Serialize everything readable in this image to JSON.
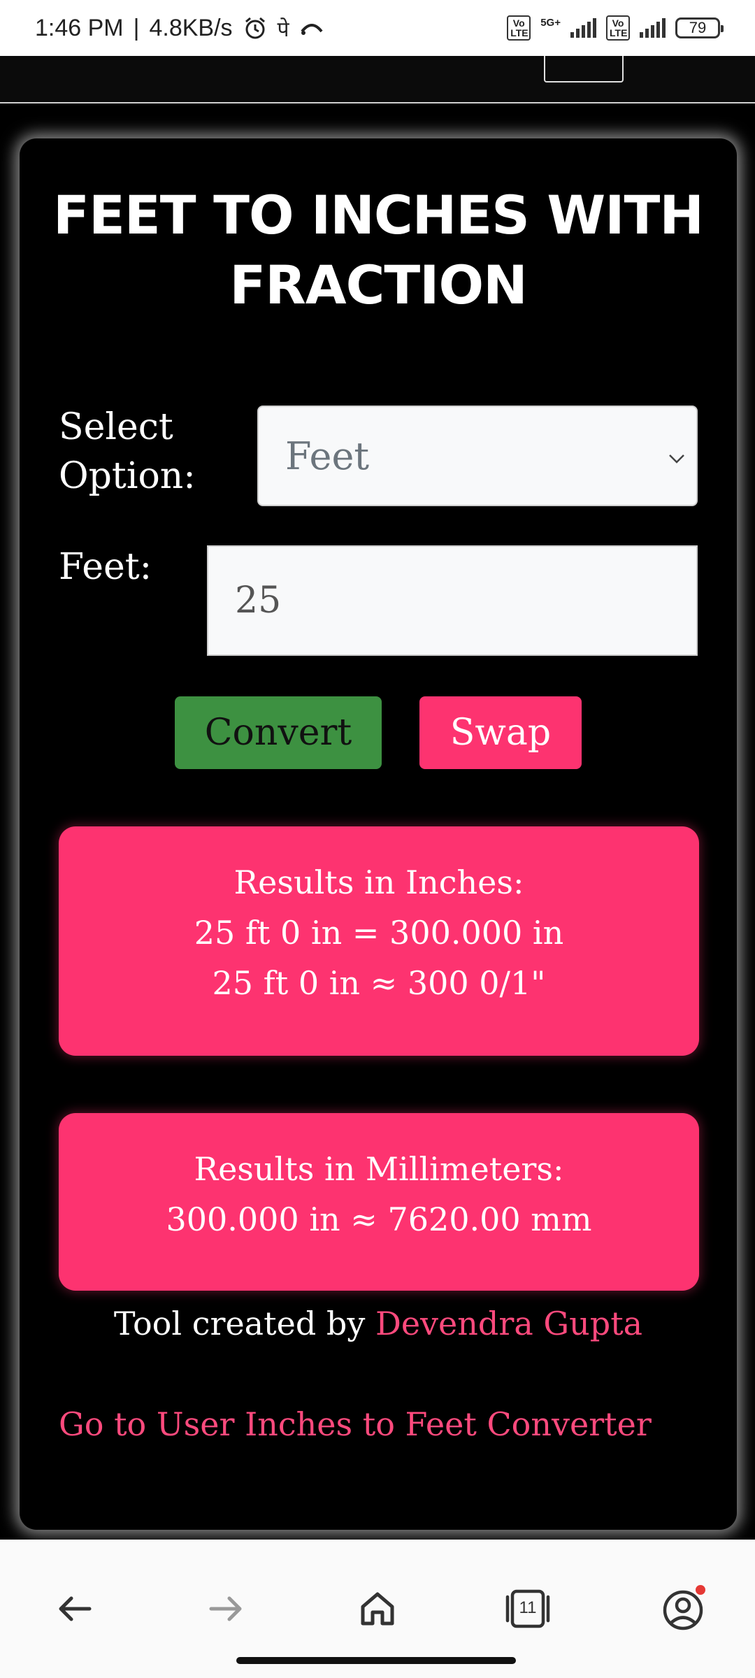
{
  "status_bar": {
    "time": "1:46 PM",
    "speed": "4.8KB/s",
    "network": "5G+",
    "volte_label": "Vo LTE",
    "battery": "79"
  },
  "converter": {
    "title": "FEET TO INCHES WITH FRACTION",
    "select_label": "Select Option:",
    "select_value": "Feet",
    "feet_label": "Feet:",
    "feet_value": "25",
    "convert_label": "Convert",
    "swap_label": "Swap",
    "results_inches": {
      "heading": "Results in Inches:",
      "line1": "25 ft 0 in = 300.000 in",
      "line2": "25 ft 0 in ≈ 300 0/1\""
    },
    "results_mm": {
      "heading": "Results in Millimeters:",
      "line1": "300.000 in ≈ 7620.00 mm"
    },
    "credit_prefix": "Tool created by",
    "credit_author": "Devendra Gupta",
    "link_text": "Go to User Inches to Feet Converter"
  },
  "bottom_nav": {
    "tab_count": "11"
  },
  "colors": {
    "accent": "#fd3370",
    "convert": "#3d9141",
    "background": "#000000"
  }
}
